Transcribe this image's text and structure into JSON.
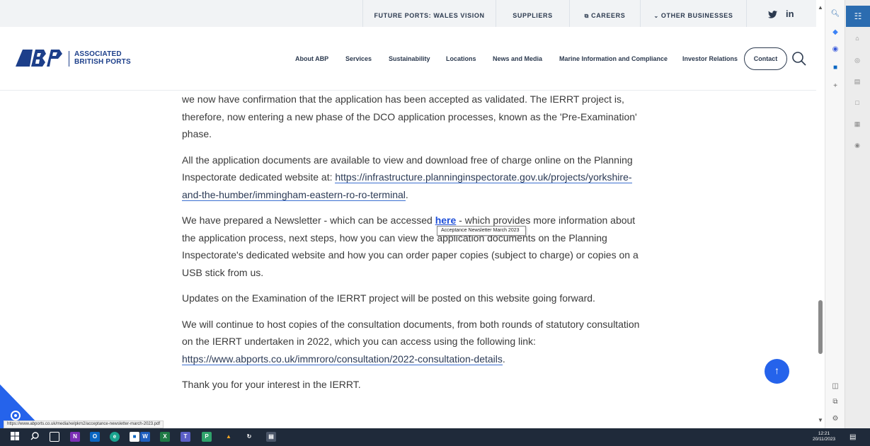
{
  "topbar": {
    "vision": "FUTURE PORTS: WALES VISION",
    "suppliers": "SUPPLIERS",
    "careers": "CAREERS",
    "other": "OTHER BUSINESSES"
  },
  "logo": {
    "line1": "ASSOCIATED",
    "line2": "BRITISH PORTS"
  },
  "nav": {
    "about": "About ABP",
    "services": "Services",
    "sustainability": "Sustainability",
    "locations": "Locations",
    "news": "News and Media",
    "marine": "Marine Information and Compliance",
    "investor": "Investor Relations",
    "contact": "Contact"
  },
  "content": {
    "p1": "we now have confirmation that the application has been accepted as validated. The IERRT project is, therefore, now entering a new phase of the DCO application processes, known as the 'Pre-Examination' phase.",
    "p2_pre": "All the application documents are available to view and download free of charge online on the Planning Inspectorate dedicated website at: ",
    "p2_link": "https://infrastructure.planninginspectorate.gov.uk/projects/yorkshire-and-the-humber/immingham-eastern-ro-ro-terminal",
    "p2_post": ".",
    "p3_pre": "We have prepared a Newsletter - which can be accessed ",
    "p3_link": "here",
    "p3_post": " - which provides more information about the application process, next steps, how you can view the application documents on the Planning Inspectorate's dedicated website and how you can order paper copies (subject to charge) or copies on a USB stick from us.",
    "p4": "Updates on the Examination of the IERRT project will be posted on this website going forward.",
    "p5_pre": "We will continue to host copies of the consultation documents, from both rounds of statutory consultation on the IERRT undertaken in 2022, which you can access using the following link: ",
    "p5_link": "https://www.abports.co.uk/immroro/consultation/2022-consultation-details",
    "p5_post": ".",
    "p6": "Thank you for your interest in the IERRT."
  },
  "tooltip": "Acceptance Newsletter March 2023",
  "status_url": "https://www.abports.co.uk/media/xelpkm2/acceptance-newsletter-march-2023.pdf",
  "clock": {
    "time": "12:21",
    "date": "20/11/2023"
  },
  "colors": {
    "brand": "#1d3f8a",
    "link": "#1d4ed8",
    "accent": "#2563eb",
    "taskbar": "#1f2a3a"
  }
}
